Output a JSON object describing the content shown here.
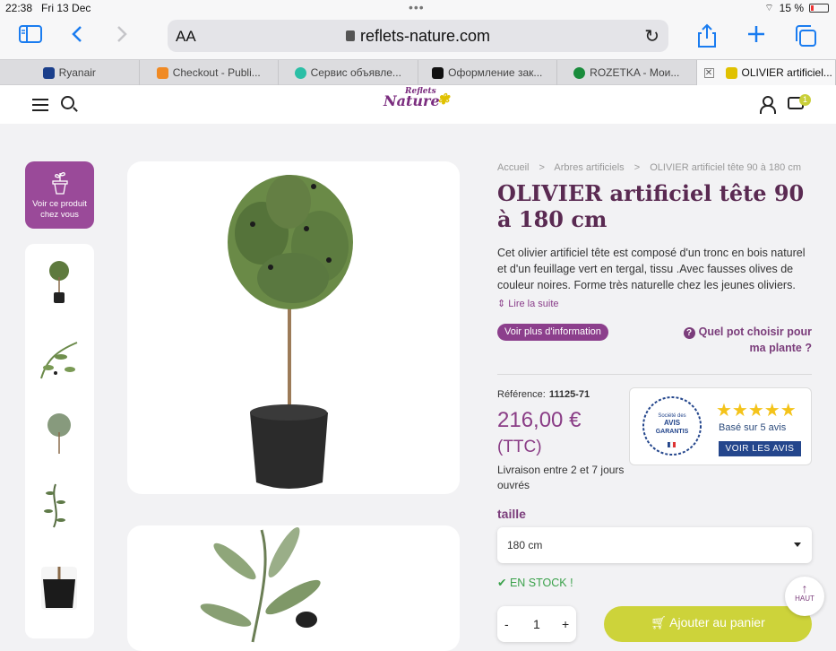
{
  "status": {
    "time": "22:38",
    "date": "Fri 13 Dec",
    "battery": "15 %"
  },
  "browser": {
    "aa": "AA",
    "url": "reflets-nature.com",
    "tabs": [
      {
        "label": "Ryanair",
        "fav_color": "#1b3f8b"
      },
      {
        "label": "Checkout - Publi...",
        "fav_color": "#f08a24"
      },
      {
        "label": "Сервис объявле...",
        "fav_color": "#2bbfa6"
      },
      {
        "label": "Оформление зак...",
        "fav_color": "#111111"
      },
      {
        "label": "ROZETKA - Мои...",
        "fav_color": "#1a8c3c"
      },
      {
        "label": "OLIVIER artificiel...",
        "fav_color": "#e0c100"
      }
    ]
  },
  "site": {
    "logo_small": "Reflets",
    "logo_main": "Nature",
    "cart_count": "1",
    "vr_label": "Voir ce produit chez vous"
  },
  "product": {
    "breadcrumb": [
      "Accueil",
      ">",
      "Arbres artificiels",
      ">",
      "OLIVIER artificiel tête 90 à 180 cm"
    ],
    "title": "OLIVIER artificiel tête 90 à 180 cm",
    "description": "Cet olivier artificiel tête est composé d'un tronc en bois naturel et d'un feuillage vert en tergal, tissu .Avec fausses olives de couleur noires. Forme très naturelle chez les jeunes oliviers.",
    "read_more": "Lire la suite",
    "more_info": "Voir plus d'information",
    "pot_question": "Quel pot choisir pour ma plante ?",
    "reference_label": "Référence:",
    "reference": "11125-71",
    "price": "216,00 €",
    "ttc": "(TTC)",
    "delivery": "Livraison entre 2 et 7 jours ouvrés",
    "size_label": "taille",
    "size_value": "180 cm",
    "stock": "EN STOCK !",
    "qty_minus": "-",
    "qty": "1",
    "qty_plus": "+",
    "add_to_cart": "Ajouter au panier",
    "top_button": "HAUT"
  },
  "reviews": {
    "seal_line1": "Société des",
    "seal_line2": "AVIS",
    "seal_line3": "GARANTIS",
    "stars": "★★★★★",
    "based_on": "Basé sur 5 avis",
    "see_reviews": "VOIR LES AVIS"
  }
}
